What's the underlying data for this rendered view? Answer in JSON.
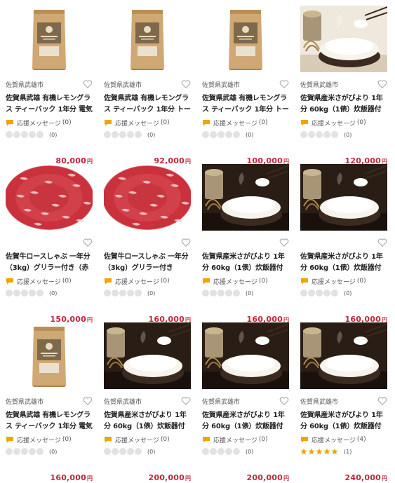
{
  "colors": {
    "price": "#c0273c",
    "accent_star": "#f0a500",
    "msg_icon": "#f2a400"
  },
  "products": [
    {
      "image": "tea-pouch",
      "region": "佐賀県武雄市",
      "title": "佐賀県武雄 有機レモングラス ティーバック 1年分 電気ポッ",
      "messages_label": "応援メッセージ",
      "messages_count": "(0)",
      "rating": 0,
      "reviews": "(0)",
      "price": "80,000",
      "yen": "円"
    },
    {
      "image": "tea-pouch",
      "region": "佐賀県武雄市",
      "title": "佐賀県武雄 有機レモングラス ティーバック 1年分 トース",
      "messages_label": "応援メッセージ",
      "messages_count": "(0)",
      "rating": 0,
      "reviews": "(0)",
      "price": "92,000",
      "yen": "円"
    },
    {
      "image": "tea-pouch",
      "region": "佐賀県武雄市",
      "title": "佐賀県武雄 有機レモングラス ティーバック 1年分 トース",
      "messages_label": "応援メッセージ",
      "messages_count": "(0)",
      "rating": 0,
      "reviews": "(0)",
      "price": "100,000",
      "yen": "円"
    },
    {
      "image": "rice-bowl-light",
      "region": "佐賀県武雄市",
      "title": "佐賀県産米さがびより 1年分 60kg（1俵）炊飯器付き（銘",
      "messages_label": "応援メッセージ",
      "messages_count": "(0)",
      "rating": 0,
      "reviews": "(0)",
      "price": "120,000",
      "yen": "円"
    },
    {
      "image": "beef",
      "region": "",
      "title": "佐賀牛ロースしゃぶ 一年分（3kg）グリラー付き（赤外",
      "messages_label": "応援メッセージ",
      "messages_count": "(0)",
      "rating": 0,
      "reviews": "(0)",
      "price": "150,000",
      "yen": "円"
    },
    {
      "image": "beef",
      "region": "",
      "title": "佐賀牛ロースしゃぶ 一年分（3kg）グリラー付き",
      "messages_label": "応援メッセージ",
      "messages_count": "(0)",
      "rating": 0,
      "reviews": "(0)",
      "price": "160,000",
      "yen": "円"
    },
    {
      "image": "rice-bowl-dark",
      "region": "",
      "title": "佐賀県産米さがびより 1年分 60kg（1俵）炊飯器付き",
      "messages_label": "応援メッセージ",
      "messages_count": "(0)",
      "rating": 0,
      "reviews": "(0)",
      "price": "160,000",
      "yen": "円"
    },
    {
      "image": "rice-bowl-dark",
      "region": "",
      "title": "佐賀県産米さがびより 1年分 60kg（1俵）炊飯器付き",
      "messages_label": "応援メッセージ",
      "messages_count": "(0)",
      "rating": 0,
      "reviews": "(0)",
      "price": "160,000",
      "yen": "円"
    },
    {
      "image": "tea-pouch",
      "region": "佐賀県武雄市",
      "title": "佐賀県武雄 有機レモングラス ティーバック 1年分 電気ケト",
      "messages_label": "応援メッセージ",
      "messages_count": "(0)",
      "rating": 0,
      "reviews": "(0)",
      "price": "160,000",
      "yen": "円"
    },
    {
      "image": "rice-bowl-dark",
      "region": "佐賀県武雄市",
      "title": "佐賀県産米さがびより 1年分 60kg（1俵）炊飯器付き（打",
      "messages_label": "応援メッセージ",
      "messages_count": "(0)",
      "rating": 0,
      "reviews": "(0)",
      "price": "200,000",
      "yen": "円"
    },
    {
      "image": "rice-bowl-dark",
      "region": "佐賀県武雄市",
      "title": "佐賀県産米さがびより 1年分 60kg（1俵）炊飯器付き（打",
      "messages_label": "応援メッセージ",
      "messages_count": "(0)",
      "rating": 0,
      "reviews": "(0)",
      "price": "200,000",
      "yen": "円"
    },
    {
      "image": "rice-bowl-dark",
      "region": "佐賀県武雄市",
      "title": "佐賀県産米さがびより 1年分 60kg（1俵）炊飯器付き（",
      "messages_label": "応援メッセージ",
      "messages_count": "(4)",
      "rating": 5,
      "reviews": "(1)",
      "price": "240,000",
      "yen": "円"
    }
  ]
}
